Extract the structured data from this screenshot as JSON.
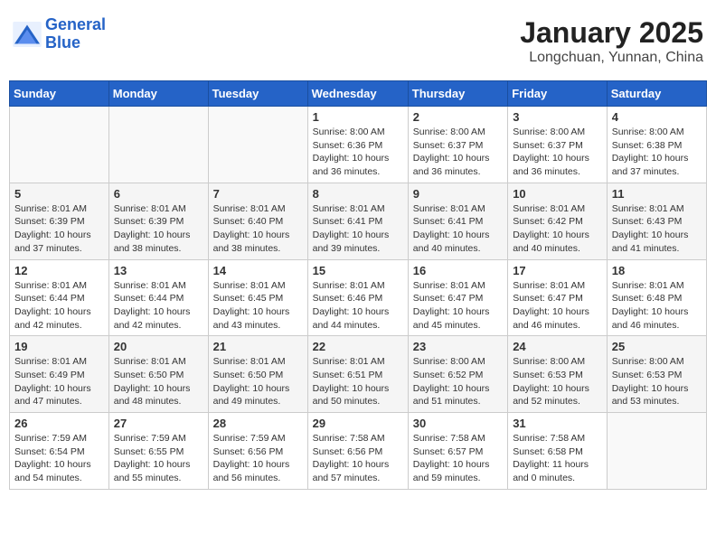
{
  "logo": {
    "line1": "General",
    "line2": "Blue"
  },
  "title": "January 2025",
  "subtitle": "Longchuan, Yunnan, China",
  "weekdays": [
    "Sunday",
    "Monday",
    "Tuesday",
    "Wednesday",
    "Thursday",
    "Friday",
    "Saturday"
  ],
  "weeks": [
    [
      {
        "day": "",
        "info": ""
      },
      {
        "day": "",
        "info": ""
      },
      {
        "day": "",
        "info": ""
      },
      {
        "day": "1",
        "info": "Sunrise: 8:00 AM\nSunset: 6:36 PM\nDaylight: 10 hours\nand 36 minutes."
      },
      {
        "day": "2",
        "info": "Sunrise: 8:00 AM\nSunset: 6:37 PM\nDaylight: 10 hours\nand 36 minutes."
      },
      {
        "day": "3",
        "info": "Sunrise: 8:00 AM\nSunset: 6:37 PM\nDaylight: 10 hours\nand 36 minutes."
      },
      {
        "day": "4",
        "info": "Sunrise: 8:00 AM\nSunset: 6:38 PM\nDaylight: 10 hours\nand 37 minutes."
      }
    ],
    [
      {
        "day": "5",
        "info": "Sunrise: 8:01 AM\nSunset: 6:39 PM\nDaylight: 10 hours\nand 37 minutes."
      },
      {
        "day": "6",
        "info": "Sunrise: 8:01 AM\nSunset: 6:39 PM\nDaylight: 10 hours\nand 38 minutes."
      },
      {
        "day": "7",
        "info": "Sunrise: 8:01 AM\nSunset: 6:40 PM\nDaylight: 10 hours\nand 38 minutes."
      },
      {
        "day": "8",
        "info": "Sunrise: 8:01 AM\nSunset: 6:41 PM\nDaylight: 10 hours\nand 39 minutes."
      },
      {
        "day": "9",
        "info": "Sunrise: 8:01 AM\nSunset: 6:41 PM\nDaylight: 10 hours\nand 40 minutes."
      },
      {
        "day": "10",
        "info": "Sunrise: 8:01 AM\nSunset: 6:42 PM\nDaylight: 10 hours\nand 40 minutes."
      },
      {
        "day": "11",
        "info": "Sunrise: 8:01 AM\nSunset: 6:43 PM\nDaylight: 10 hours\nand 41 minutes."
      }
    ],
    [
      {
        "day": "12",
        "info": "Sunrise: 8:01 AM\nSunset: 6:44 PM\nDaylight: 10 hours\nand 42 minutes."
      },
      {
        "day": "13",
        "info": "Sunrise: 8:01 AM\nSunset: 6:44 PM\nDaylight: 10 hours\nand 42 minutes."
      },
      {
        "day": "14",
        "info": "Sunrise: 8:01 AM\nSunset: 6:45 PM\nDaylight: 10 hours\nand 43 minutes."
      },
      {
        "day": "15",
        "info": "Sunrise: 8:01 AM\nSunset: 6:46 PM\nDaylight: 10 hours\nand 44 minutes."
      },
      {
        "day": "16",
        "info": "Sunrise: 8:01 AM\nSunset: 6:47 PM\nDaylight: 10 hours\nand 45 minutes."
      },
      {
        "day": "17",
        "info": "Sunrise: 8:01 AM\nSunset: 6:47 PM\nDaylight: 10 hours\nand 46 minutes."
      },
      {
        "day": "18",
        "info": "Sunrise: 8:01 AM\nSunset: 6:48 PM\nDaylight: 10 hours\nand 46 minutes."
      }
    ],
    [
      {
        "day": "19",
        "info": "Sunrise: 8:01 AM\nSunset: 6:49 PM\nDaylight: 10 hours\nand 47 minutes."
      },
      {
        "day": "20",
        "info": "Sunrise: 8:01 AM\nSunset: 6:50 PM\nDaylight: 10 hours\nand 48 minutes."
      },
      {
        "day": "21",
        "info": "Sunrise: 8:01 AM\nSunset: 6:50 PM\nDaylight: 10 hours\nand 49 minutes."
      },
      {
        "day": "22",
        "info": "Sunrise: 8:01 AM\nSunset: 6:51 PM\nDaylight: 10 hours\nand 50 minutes."
      },
      {
        "day": "23",
        "info": "Sunrise: 8:00 AM\nSunset: 6:52 PM\nDaylight: 10 hours\nand 51 minutes."
      },
      {
        "day": "24",
        "info": "Sunrise: 8:00 AM\nSunset: 6:53 PM\nDaylight: 10 hours\nand 52 minutes."
      },
      {
        "day": "25",
        "info": "Sunrise: 8:00 AM\nSunset: 6:53 PM\nDaylight: 10 hours\nand 53 minutes."
      }
    ],
    [
      {
        "day": "26",
        "info": "Sunrise: 7:59 AM\nSunset: 6:54 PM\nDaylight: 10 hours\nand 54 minutes."
      },
      {
        "day": "27",
        "info": "Sunrise: 7:59 AM\nSunset: 6:55 PM\nDaylight: 10 hours\nand 55 minutes."
      },
      {
        "day": "28",
        "info": "Sunrise: 7:59 AM\nSunset: 6:56 PM\nDaylight: 10 hours\nand 56 minutes."
      },
      {
        "day": "29",
        "info": "Sunrise: 7:58 AM\nSunset: 6:56 PM\nDaylight: 10 hours\nand 57 minutes."
      },
      {
        "day": "30",
        "info": "Sunrise: 7:58 AM\nSunset: 6:57 PM\nDaylight: 10 hours\nand 59 minutes."
      },
      {
        "day": "31",
        "info": "Sunrise: 7:58 AM\nSunset: 6:58 PM\nDaylight: 11 hours\nand 0 minutes."
      },
      {
        "day": "",
        "info": ""
      }
    ]
  ]
}
